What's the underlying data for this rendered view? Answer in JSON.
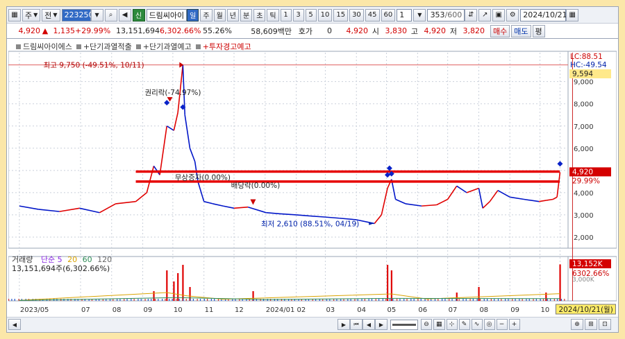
{
  "toolbar": {
    "menu_label": "주",
    "market_label": "전",
    "stock_code": "223250",
    "tag_label": "신",
    "stock_name": "드림씨아이",
    "periods": [
      "일",
      "주",
      "월",
      "년",
      "분",
      "초",
      "틱"
    ],
    "intervals": [
      "1",
      "3",
      "5",
      "10",
      "15",
      "30",
      "45",
      "60"
    ],
    "unit_value": "1",
    "page_position": "353",
    "page_total": "/600",
    "date": "2024/10/21"
  },
  "quote": {
    "price": "4,920",
    "arrow": "▲",
    "change": "1,135",
    "change_pct": "+29.99%",
    "volume": "13,151,694",
    "volume_pct": "6,302.66%",
    "ratio": "55.26%",
    "amount": "58,609백만",
    "ask_label": "호가",
    "ask_value": "0",
    "last": "4,920",
    "open_label": "시",
    "open": "3,830",
    "high_label": "고",
    "high": "4,920",
    "low_label": "저",
    "low": "3,820",
    "sell_label": "매수",
    "buy_label": "매도",
    "avg_label": "평"
  },
  "legend": {
    "name": "드림씨아이에스",
    "items": [
      "+단기과열적출",
      "+단기과열예고",
      "+투자경고예고"
    ]
  },
  "volume_legend": {
    "title": "거래량",
    "ma_label": "단순",
    "ma_periods": [
      "5",
      "20",
      "60",
      "120"
    ],
    "value": "13,151,694주(6,302.66%)"
  },
  "right_axis": {
    "lc": "LC:88.51",
    "hc": "HC:-49.54",
    "high_box": "9,594",
    "price_box": "4,920",
    "pct_box": "29.99%",
    "vol_box": "13,152K",
    "vol_pct_box": "6302.66%",
    "vol_tick_below": "3,000K"
  },
  "annotations": {
    "high": "최고 9,750 (-49.51%, 10/11)",
    "rights": "권리락(-74.97%)",
    "bonus": "무상증자(0.00%)",
    "dividend": "배당락(0.00%)",
    "low": "최저 2,610 (88.51%, 04/19)"
  },
  "bottom": {
    "cursor_date": "2024/10/21(월)",
    "next_label": "21"
  },
  "chart_data": {
    "type": "line",
    "title": "드림씨아이에스",
    "xlabel": "",
    "ylabel": "",
    "ylim": [
      1500,
      10300
    ],
    "y_ticks": [
      2000,
      3000,
      4000,
      5000,
      6000,
      7000,
      8000,
      9000
    ],
    "x_tick_labels": [
      "2023/05",
      "07",
      "08",
      "09",
      "10",
      "11",
      "12",
      "2024/01",
      "02",
      "03",
      "04",
      "05",
      "06",
      "07",
      "08",
      "09",
      "10",
      "21"
    ],
    "price_series": {
      "name": "주가",
      "x": [
        "2023-05-01",
        "2023-05-20",
        "2023-06-10",
        "2023-06-30",
        "2023-07-20",
        "2023-08-05",
        "2023-08-25",
        "2023-09-05",
        "2023-09-12",
        "2023-09-18",
        "2023-09-25",
        "2023-10-02",
        "2023-10-06",
        "2023-10-11",
        "2023-10-13",
        "2023-10-18",
        "2023-10-23",
        "2023-10-26",
        "2023-11-01",
        "2023-11-10",
        "2023-11-20",
        "2023-12-01",
        "2023-12-15",
        "2024-01-02",
        "2024-01-15",
        "2024-02-01",
        "2024-02-15",
        "2024-03-01",
        "2024-03-15",
        "2024-04-01",
        "2024-04-19",
        "2024-04-26",
        "2024-05-02",
        "2024-05-06",
        "2024-05-10",
        "2024-05-20",
        "2024-06-05",
        "2024-06-20",
        "2024-07-01",
        "2024-07-10",
        "2024-07-20",
        "2024-08-01",
        "2024-08-05",
        "2024-08-12",
        "2024-08-20",
        "2024-09-01",
        "2024-09-15",
        "2024-09-30",
        "2024-10-07",
        "2024-10-14",
        "2024-10-18",
        "2024-10-21"
      ],
      "y": [
        3400,
        3250,
        3150,
        3300,
        3100,
        3500,
        3600,
        4000,
        5200,
        4800,
        7000,
        6800,
        7600,
        9750,
        7500,
        6000,
        5400,
        4500,
        3600,
        3500,
        3400,
        3300,
        3350,
        3100,
        3050,
        3000,
        2950,
        2900,
        2850,
        2780,
        2610,
        3000,
        4200,
        4600,
        3700,
        3500,
        3400,
        3450,
        3700,
        4300,
        4000,
        4200,
        3300,
        3600,
        4100,
        3800,
        3700,
        3600,
        3650,
        3700,
        3800,
        4920
      ]
    },
    "resistance_lines": [
      4950,
      4500
    ],
    "volume_series": {
      "name": "거래량",
      "x": [
        "2023-05-01",
        "2023-09-12",
        "2023-09-25",
        "2023-10-02",
        "2023-10-06",
        "2023-10-11",
        "2023-10-18",
        "2023-12-20",
        "2024-05-02",
        "2024-05-06",
        "2024-07-10",
        "2024-08-01",
        "2024-10-07",
        "2024-10-21"
      ],
      "values": [
        80,
        3500,
        11000,
        7000,
        10000,
        13000,
        5000,
        3500,
        13000,
        11000,
        3000,
        5000,
        3000,
        13152
      ]
    }
  },
  "colors": {
    "up": "#e00000",
    "down": "#0015c8",
    "resistance": "#e60000",
    "highlight": "#ffed69"
  }
}
